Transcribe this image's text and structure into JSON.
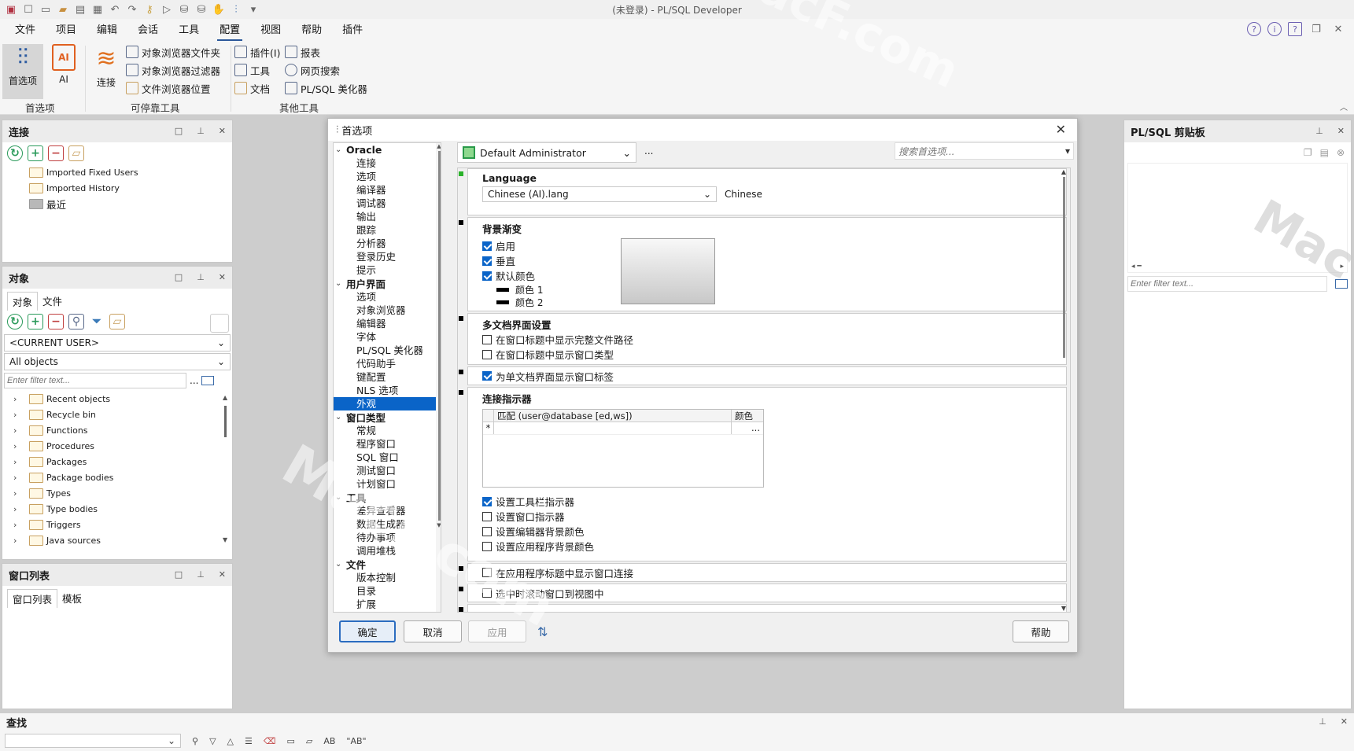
{
  "title": "(未登录) - PL/SQL Developer",
  "menu": [
    "文件",
    "项目",
    "编辑",
    "会话",
    "工具",
    "配置",
    "视图",
    "帮助",
    "插件"
  ],
  "ribbon": {
    "pref_label": "首选项",
    "ai_label": "AI",
    "connect_label": "连接",
    "obj_folders": "对象浏览器文件夹",
    "obj_filters": "对象浏览器过滤器",
    "file_loc": "文件浏览器位置",
    "plugins": "插件(I)",
    "tools": "工具",
    "docs": "文档",
    "reports": "报表",
    "websearch": "网页搜索",
    "beautifier": "PL/SQL 美化器",
    "grp_pref": "首选项",
    "grp_dock": "可停靠工具",
    "grp_other": "其他工具"
  },
  "conn_panel": {
    "title": "连接",
    "items": [
      "Imported Fixed Users",
      "Imported History",
      "最近"
    ]
  },
  "obj_panel": {
    "title": "对象",
    "tabs": [
      "对象",
      "文件"
    ],
    "user": "<CURRENT USER>",
    "filter": "All objects",
    "filter_ph": "Enter filter text...",
    "ellipsis": "...",
    "items": [
      "Recent objects",
      "Recycle bin",
      "Functions",
      "Procedures",
      "Packages",
      "Package bodies",
      "Types",
      "Type bodies",
      "Triggers",
      "Java sources"
    ]
  },
  "win_panel": {
    "title": "窗口列表",
    "tabs": [
      "窗口列表",
      "模板"
    ]
  },
  "clip_panel": {
    "title": "PL/SQL 剪贴板",
    "filter_ph": "Enter filter text..."
  },
  "find": {
    "title": "查找",
    "ab1": "AB",
    "ab2": "\"AB\""
  },
  "dialog": {
    "title": "首选项",
    "profile": "Default Administrator",
    "dots": "...",
    "search_ph": "搜索首选项...",
    "nav": [
      {
        "cat": "Oracle",
        "items": [
          "连接",
          "选项",
          "编译器",
          "调试器",
          "输出",
          "跟踪",
          "分析器",
          "登录历史",
          "提示"
        ]
      },
      {
        "cat": "用户界面",
        "items": [
          "选项",
          "对象浏览器",
          "编辑器",
          "字体",
          "PL/SQL 美化器",
          "代码助手",
          "键配置",
          "NLS 选项",
          "外观"
        ]
      },
      {
        "cat": "窗口类型",
        "items": [
          "常规",
          "程序窗口",
          "SQL 窗口",
          "测试窗口",
          "计划窗口"
        ]
      },
      {
        "cat": "工具",
        "items": [
          "差异查看器",
          "数据生成器",
          "待办事项",
          "调用堆栈"
        ]
      },
      {
        "cat": "文件",
        "items": [
          "版本控制",
          "目录",
          "扩展"
        ]
      }
    ],
    "language": {
      "title": "Language",
      "value": "Chinese (AI).lang",
      "desc": "Chinese"
    },
    "gradient": {
      "title": "背景渐变",
      "enable": "启用",
      "vertical": "垂直",
      "default_color": "默认颜色",
      "color1": "颜色 1",
      "color2": "颜色 2"
    },
    "mdi": {
      "title": "多文档界面设置",
      "opt1": "在窗口标题中显示完整文件路径",
      "opt2": "在窗口标题中显示窗口类型"
    },
    "sdi_tabs": "为单文档界面显示窗口标签",
    "conn_ind": {
      "title": "连接指示器",
      "col1": "匹配 (user@database [ed,ws])",
      "col2": "颜色",
      "row_star": "*",
      "row_dots": "...",
      "opt1": "设置工具栏指示器",
      "opt2": "设置窗口指示器",
      "opt3": "设置编辑器背景颜色",
      "opt4": "设置应用程序背景颜色"
    },
    "app_title_conn": "在应用程序标题中显示窗口连接",
    "scroll_view": "选中时滚动窗口到视图中",
    "ok": "确定",
    "cancel": "取消",
    "apply": "应用",
    "help": "帮助"
  },
  "watermark": "MacF.com"
}
